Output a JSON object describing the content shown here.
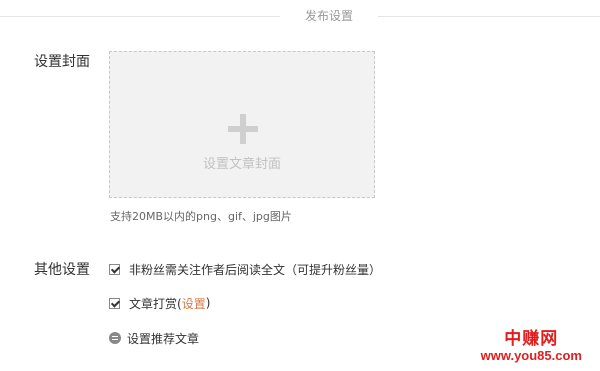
{
  "section": {
    "title": "发布设置"
  },
  "cover": {
    "label": "设置封面",
    "upload_label": "设置文章封面",
    "hint": "支持20MB以内的png、gif、jpg图片",
    "upload_icon": "plus-icon"
  },
  "other": {
    "label": "其他设置",
    "options": [
      {
        "label": "非粉丝需关注作者后阅读全文（可提升粉丝量）",
        "checked": true
      },
      {
        "label_prefix": "文章打赏(",
        "link": "设置",
        "label_suffix": ")",
        "checked": true
      },
      {
        "label": "设置推荐文章",
        "icon": "recommend-icon"
      }
    ]
  },
  "watermark": {
    "main": "中赚网",
    "sub": "www.you85.com"
  },
  "colors": {
    "link": "#d9794a",
    "watermark": "#e21d1d"
  }
}
